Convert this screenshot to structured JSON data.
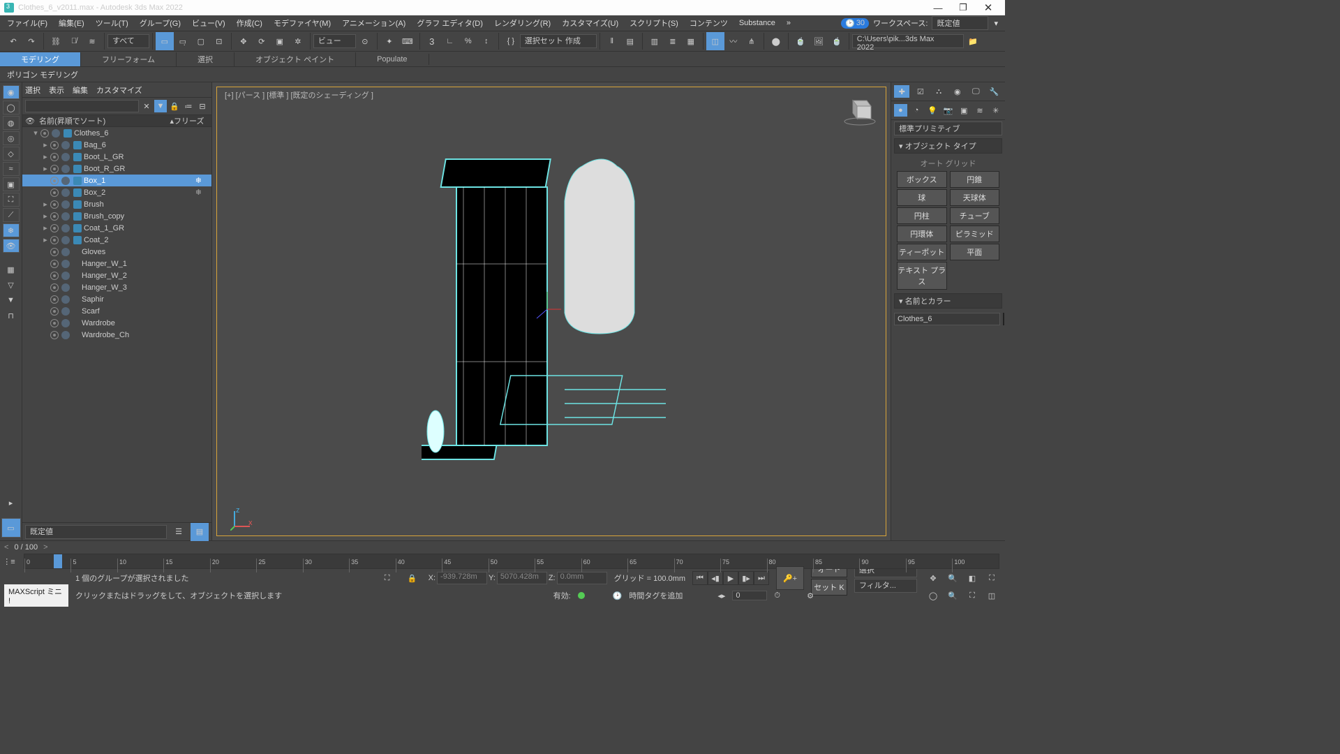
{
  "window": {
    "title": "Clothes_6_v2011.max - Autodesk 3ds Max 2022",
    "minimize": "—",
    "maximize": "❐",
    "close": "✕"
  },
  "menu": {
    "items": [
      "ファイル(F)",
      "編集(E)",
      "ツール(T)",
      "グループ(G)",
      "ビュー(V)",
      "作成(C)",
      "モデファイヤ(M)",
      "アニメーション(A)",
      "グラフ エディタ(D)",
      "レンダリング(R)",
      "カスタマイズ(U)",
      "スクリプト(S)",
      "コンテンツ",
      "Substance"
    ],
    "arrow": "»",
    "thirty": "30",
    "workspace_label": "ワークスペース:",
    "workspace_value": "既定値"
  },
  "toolbar": {
    "all": "すべて",
    "view": "ビュー",
    "selset_label": "選択セット 作成",
    "path": "C:\\Users\\pik...3ds Max 2022"
  },
  "ribbon": {
    "tabs": [
      "モデリング",
      "フリーフォーム",
      "選択",
      "オブジェクト ペイント",
      "Populate"
    ],
    "sub": "ポリゴン モデリング"
  },
  "scene_panel": {
    "menus": [
      "選択",
      "表示",
      "編集",
      "カスタマイズ"
    ],
    "sort_header": "名前(昇順でソート)",
    "freeze_header": "フリーズ",
    "nodes": [
      {
        "label": "Clothes_6",
        "level": 0,
        "expand": "▾",
        "icon": true
      },
      {
        "label": "Bag_6",
        "level": 1,
        "expand": "▸",
        "icon": true
      },
      {
        "label": "Boot_L_GR",
        "level": 1,
        "expand": "▸",
        "icon": true
      },
      {
        "label": "Boot_R_GR",
        "level": 1,
        "expand": "▸",
        "icon": true
      },
      {
        "label": "Box_1",
        "level": 1,
        "expand": "",
        "icon": true,
        "selected": true,
        "snow": true
      },
      {
        "label": "Box_2",
        "level": 1,
        "expand": "",
        "icon": true,
        "snow": true
      },
      {
        "label": "Brush",
        "level": 1,
        "expand": "▸",
        "icon": true
      },
      {
        "label": "Brush_copy",
        "level": 1,
        "expand": "▸",
        "icon": true
      },
      {
        "label": "Coat_1_GR",
        "level": 1,
        "expand": "▸",
        "icon": true
      },
      {
        "label": "Coat_2",
        "level": 1,
        "expand": "▸",
        "icon": true
      },
      {
        "label": "Gloves",
        "level": 1,
        "expand": "",
        "icon": false
      },
      {
        "label": "Hanger_W_1",
        "level": 1,
        "expand": "",
        "icon": false
      },
      {
        "label": "Hanger_W_2",
        "level": 1,
        "expand": "",
        "icon": false
      },
      {
        "label": "Hanger_W_3",
        "level": 1,
        "expand": "",
        "icon": false
      },
      {
        "label": "Saphir",
        "level": 1,
        "expand": "",
        "icon": false
      },
      {
        "label": "Scarf",
        "level": 1,
        "expand": "",
        "icon": false
      },
      {
        "label": "Wardrobe",
        "level": 1,
        "expand": "",
        "icon": false
      },
      {
        "label": "Wardrobe_Ch",
        "level": 1,
        "expand": "",
        "icon": false
      }
    ]
  },
  "layer_combo": "既定値",
  "viewport": {
    "label": "[+]  [パース ]  [標準 ]  [既定のシェーディング ]"
  },
  "cmdpanel": {
    "combo": "標準プリミティブ",
    "roll_objtype": "▾ オブジェクト タイプ",
    "autogrid": "オート グリッド",
    "prims": [
      [
        "ボックス",
        "円錐"
      ],
      [
        "球",
        "天球体"
      ],
      [
        "円柱",
        "チューブ"
      ],
      [
        "円環体",
        "ピラミッド"
      ],
      [
        "ティーポット",
        "平面"
      ],
      [
        "テキスト プラス",
        ""
      ]
    ],
    "roll_namecolor": "▾ 名前とカラー",
    "object_name": "Clothes_6"
  },
  "timeline": {
    "frame_counter": "0 / 100",
    "ticks": [
      "0",
      "5",
      "10",
      "15",
      "20",
      "25",
      "30",
      "35",
      "40",
      "45",
      "50",
      "55",
      "60",
      "65",
      "70",
      "75",
      "80",
      "85",
      "90",
      "95",
      "100"
    ]
  },
  "status": {
    "msg1": "1 個のグループが選択されました",
    "msg2": "クリックまたはドラッグをして、オブジェクトを選択します",
    "x_label": "X:",
    "x_val": "-939.728m",
    "y_label": "Y:",
    "y_val": "5070.428m",
    "z_label": "Z:",
    "z_val": "0.0mm",
    "grid": "グリッド = 100.0mm",
    "enable": "有効:",
    "timetag": "時間タグを追加",
    "auto": "オート",
    "setk": "セット K",
    "select": "選択",
    "filter": "フィルタ...",
    "frame0": "0",
    "maxscript": "MAXScript ミニ !"
  }
}
